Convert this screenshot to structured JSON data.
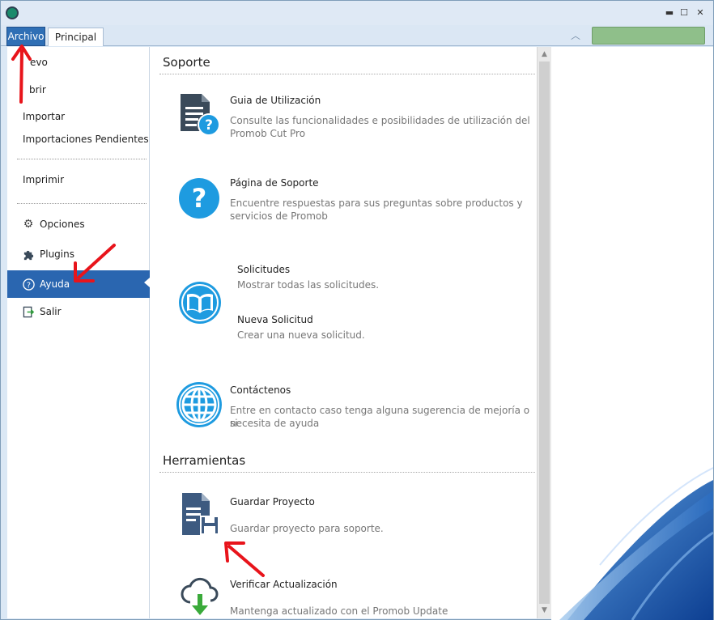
{
  "titlebar": {
    "minimize": "▬",
    "maximize": "☐",
    "close": "✕"
  },
  "tabs": {
    "archivo": "Archivo",
    "principal": "Principal"
  },
  "sidebar": {
    "items": [
      {
        "label": "Nuevo",
        "visible_label": "evo"
      },
      {
        "label": "Abrir",
        "visible_label": "brir"
      },
      {
        "label": "Importar"
      },
      {
        "label": "Importaciones Pendientes"
      },
      {
        "label": "Imprimir"
      },
      {
        "label": "Opciones",
        "icon": "gear-icon"
      },
      {
        "label": "Plugins",
        "icon": "puzzle-icon"
      },
      {
        "label": "Ayuda",
        "icon": "help-icon"
      },
      {
        "label": "Salir",
        "icon": "exit-icon"
      }
    ]
  },
  "sections": {
    "soporte": "Soporte",
    "herramientas": "Herramientas"
  },
  "entries": {
    "guia": {
      "title": "Guia de Utilización",
      "desc1": "Consulte las funcionalidades e posibilidades de utilización del",
      "desc2": "Promob Cut Pro"
    },
    "pagina": {
      "title": "Página de Soporte",
      "desc1": "Encuentre respuestas para sus preguntas sobre productos y",
      "desc2": "servicios de Promob"
    },
    "solicitudes": {
      "title": "Solicitudes",
      "desc": "Mostrar todas las solicitudes."
    },
    "nueva": {
      "title": "Nueva Solicitud",
      "desc": "Crear una nueva solicitud."
    },
    "contactenos": {
      "title": "Contáctenos",
      "desc1": "Entre en contacto caso tenga alguna sugerencia de mejoría o si",
      "desc2": "necesita de ayuda"
    },
    "guardar": {
      "title": "Guardar Proyecto",
      "desc": "Guardar proyecto para soporte."
    },
    "verificar": {
      "title": "Verificar Actualización",
      "desc": "Mantenga actualizado con el Promob Update"
    }
  },
  "colors": {
    "accent": "#2a66b0",
    "icon_blue": "#1e9be0",
    "icon_dark": "#3a4a5a",
    "arrow_red": "#e8141b"
  }
}
